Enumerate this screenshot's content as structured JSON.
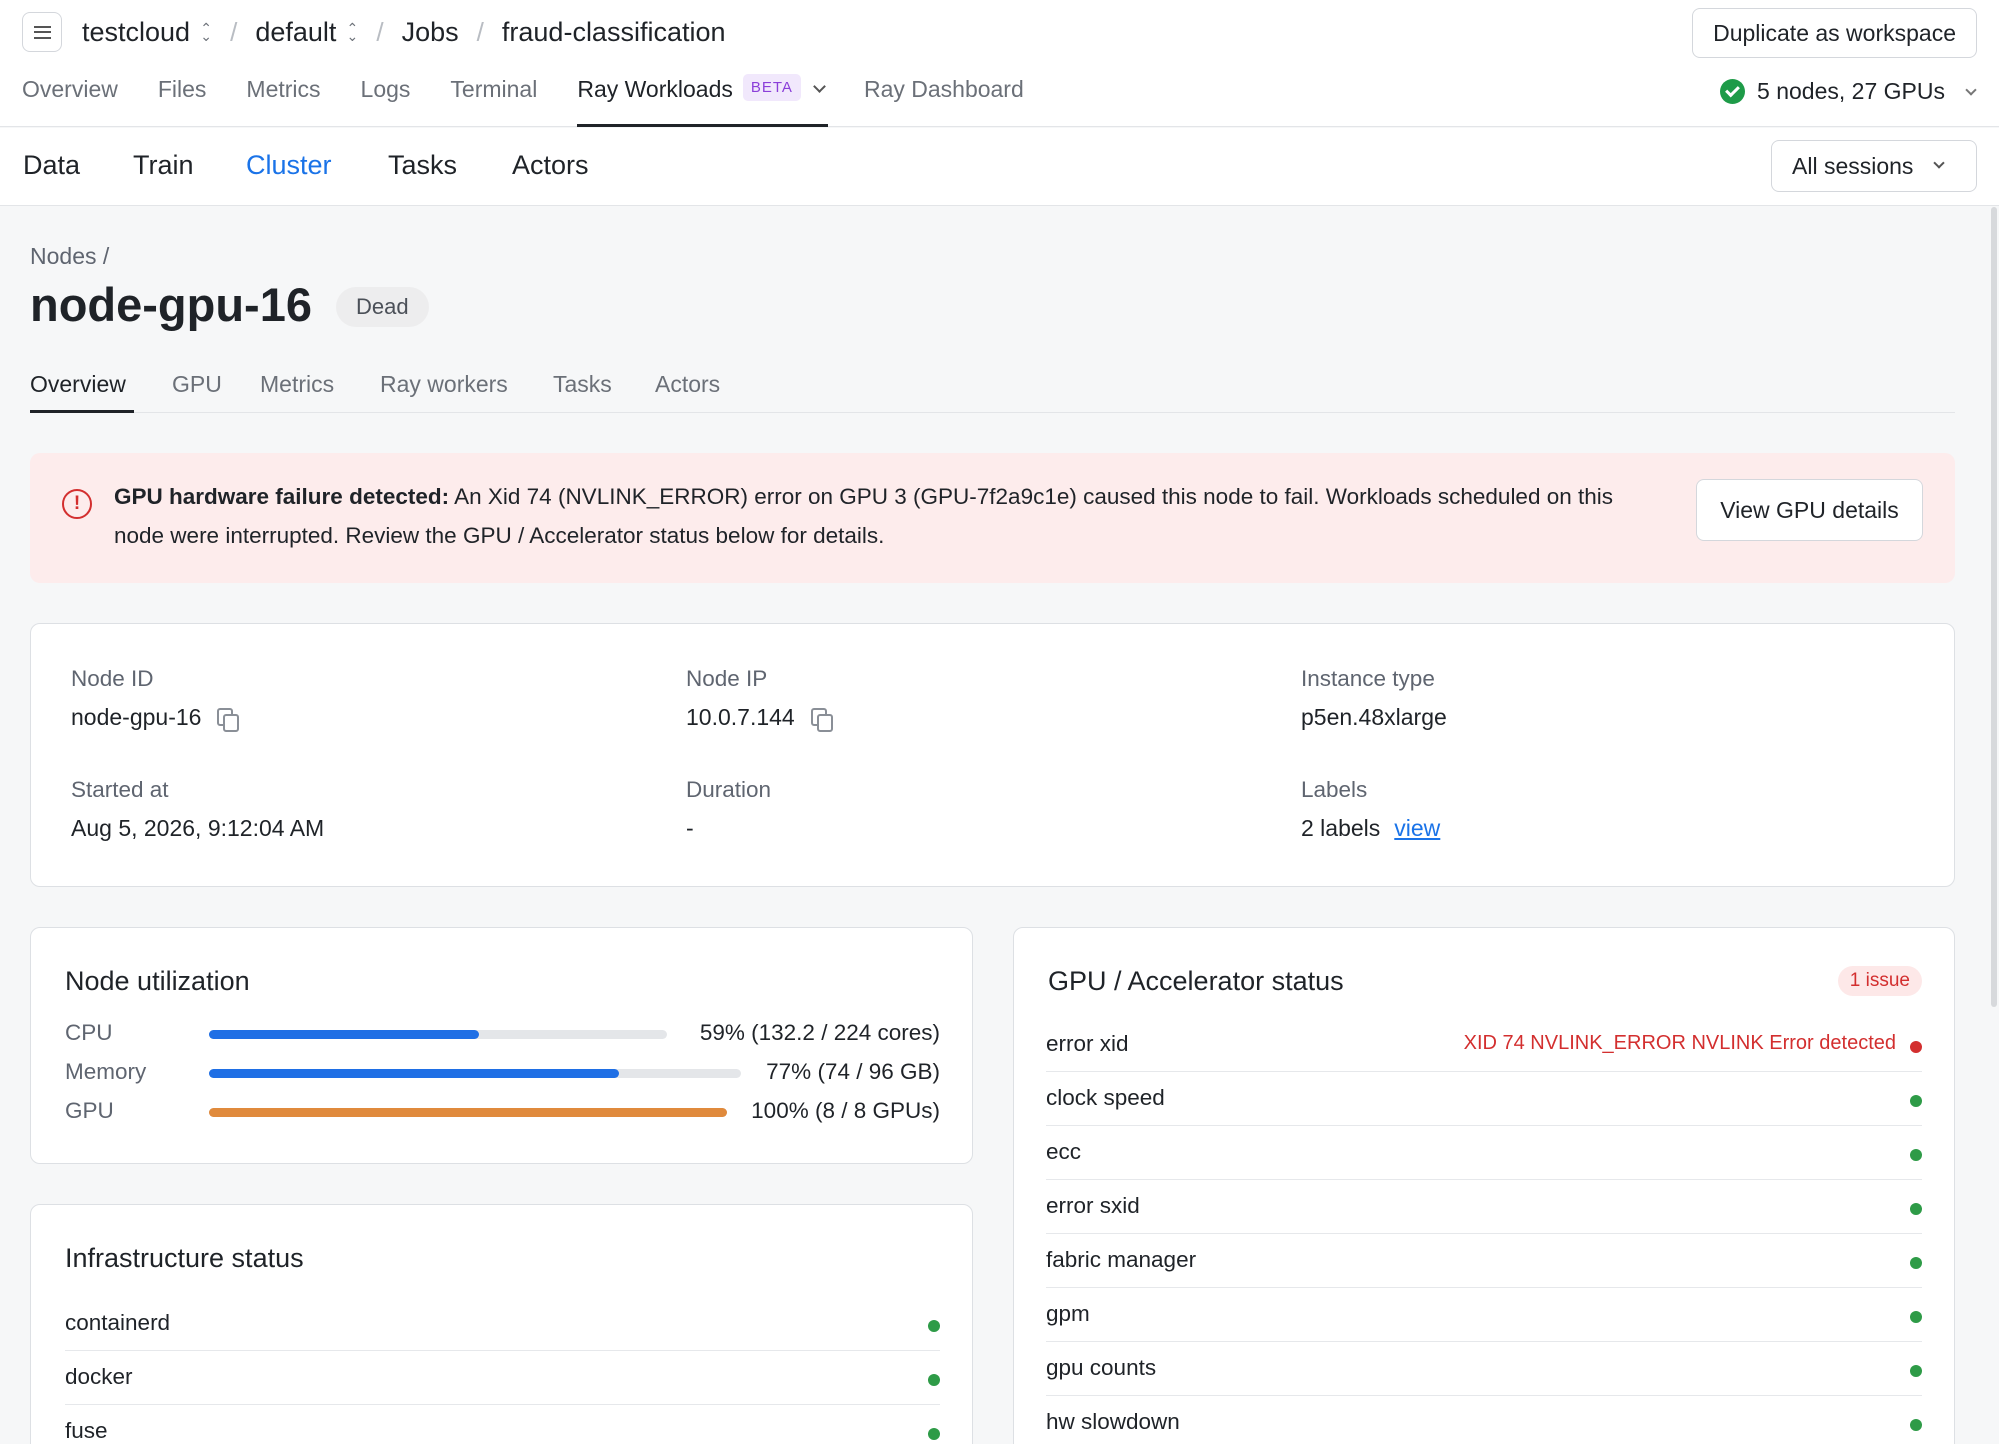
{
  "header": {
    "breadcrumbs": [
      {
        "label": "testcloud",
        "selector": true
      },
      {
        "label": "default",
        "selector": true
      },
      {
        "label": "Jobs",
        "selector": false
      },
      {
        "label": "fraud-classification",
        "selector": false
      }
    ],
    "duplicate_label": "Duplicate as workspace",
    "tabs": [
      "Overview",
      "Files",
      "Metrics",
      "Logs",
      "Terminal",
      "Ray Workloads",
      "Ray Dashboard"
    ],
    "active_tab": "Ray Workloads",
    "beta_label": "BETA",
    "cluster_status": "5 nodes, 27 GPUs",
    "cluster_status_color": "#1e9b48"
  },
  "subnav": {
    "items": [
      "Data",
      "Train",
      "Cluster",
      "Tasks",
      "Actors"
    ],
    "active": "Cluster",
    "sessions_label": "All sessions"
  },
  "node": {
    "breadcrumb": "Nodes /",
    "title": "node-gpu-16",
    "status": "Dead",
    "tabs": [
      "Overview",
      "GPU",
      "Metrics",
      "Ray workers",
      "Tasks",
      "Actors"
    ],
    "active_tab": "Overview"
  },
  "alert": {
    "title": "GPU hardware failure detected:",
    "message": "An Xid 74 (NVLINK_ERROR) error on GPU 3 (GPU-7f2a9c1e) caused this node to fail. Workloads scheduled on this node were interrupted. Review the GPU / Accelerator status below for details.",
    "button_label": "View GPU details",
    "color": "#d32f2f"
  },
  "info": {
    "node_id_label": "Node ID",
    "node_id": "node-gpu-16",
    "node_ip_label": "Node IP",
    "node_ip": "10.0.7.144",
    "instance_type_label": "Instance type",
    "instance_type": "p5en.48xlarge",
    "started_label": "Started at",
    "started": "Aug 5, 2026, 9:12:04 AM",
    "duration_label": "Duration",
    "duration": "-",
    "labels_label": "Labels",
    "labels_count": "2 labels",
    "labels_link": "view"
  },
  "utilization": {
    "title": "Node utilization",
    "rows": [
      {
        "label": "CPU",
        "value": "59% (132.2 / 224 cores)",
        "fraction": 0.59,
        "color": "#1f6fe5"
      },
      {
        "label": "Memory",
        "value": "77% (74 / 96 GB)",
        "fraction": 0.77,
        "color": "#1f6fe5"
      },
      {
        "label": "GPU",
        "value": "100% (8 / 8 GPUs)",
        "fraction": 1.0,
        "color": "#e08a3c"
      }
    ]
  },
  "infrastructure": {
    "title": "Infrastructure status",
    "rows": [
      {
        "name": "containerd",
        "status": "ok"
      },
      {
        "name": "docker",
        "status": "ok"
      },
      {
        "name": "fuse",
        "status": "ok"
      }
    ]
  },
  "gpu_status": {
    "title": "GPU / Accelerator status",
    "issue_badge": "1 issue",
    "rows": [
      {
        "name": "error xid",
        "status": "error",
        "message": "XID 74 NVLINK_ERROR NVLINK Error detected"
      },
      {
        "name": "clock speed",
        "status": "ok"
      },
      {
        "name": "ecc",
        "status": "ok"
      },
      {
        "name": "error sxid",
        "status": "ok"
      },
      {
        "name": "fabric manager",
        "status": "ok"
      },
      {
        "name": "gpm",
        "status": "ok"
      },
      {
        "name": "gpu counts",
        "status": "ok"
      },
      {
        "name": "hw slowdown",
        "status": "ok"
      }
    ],
    "ok_color": "#2e9b47",
    "error_color": "#d32f2f"
  }
}
